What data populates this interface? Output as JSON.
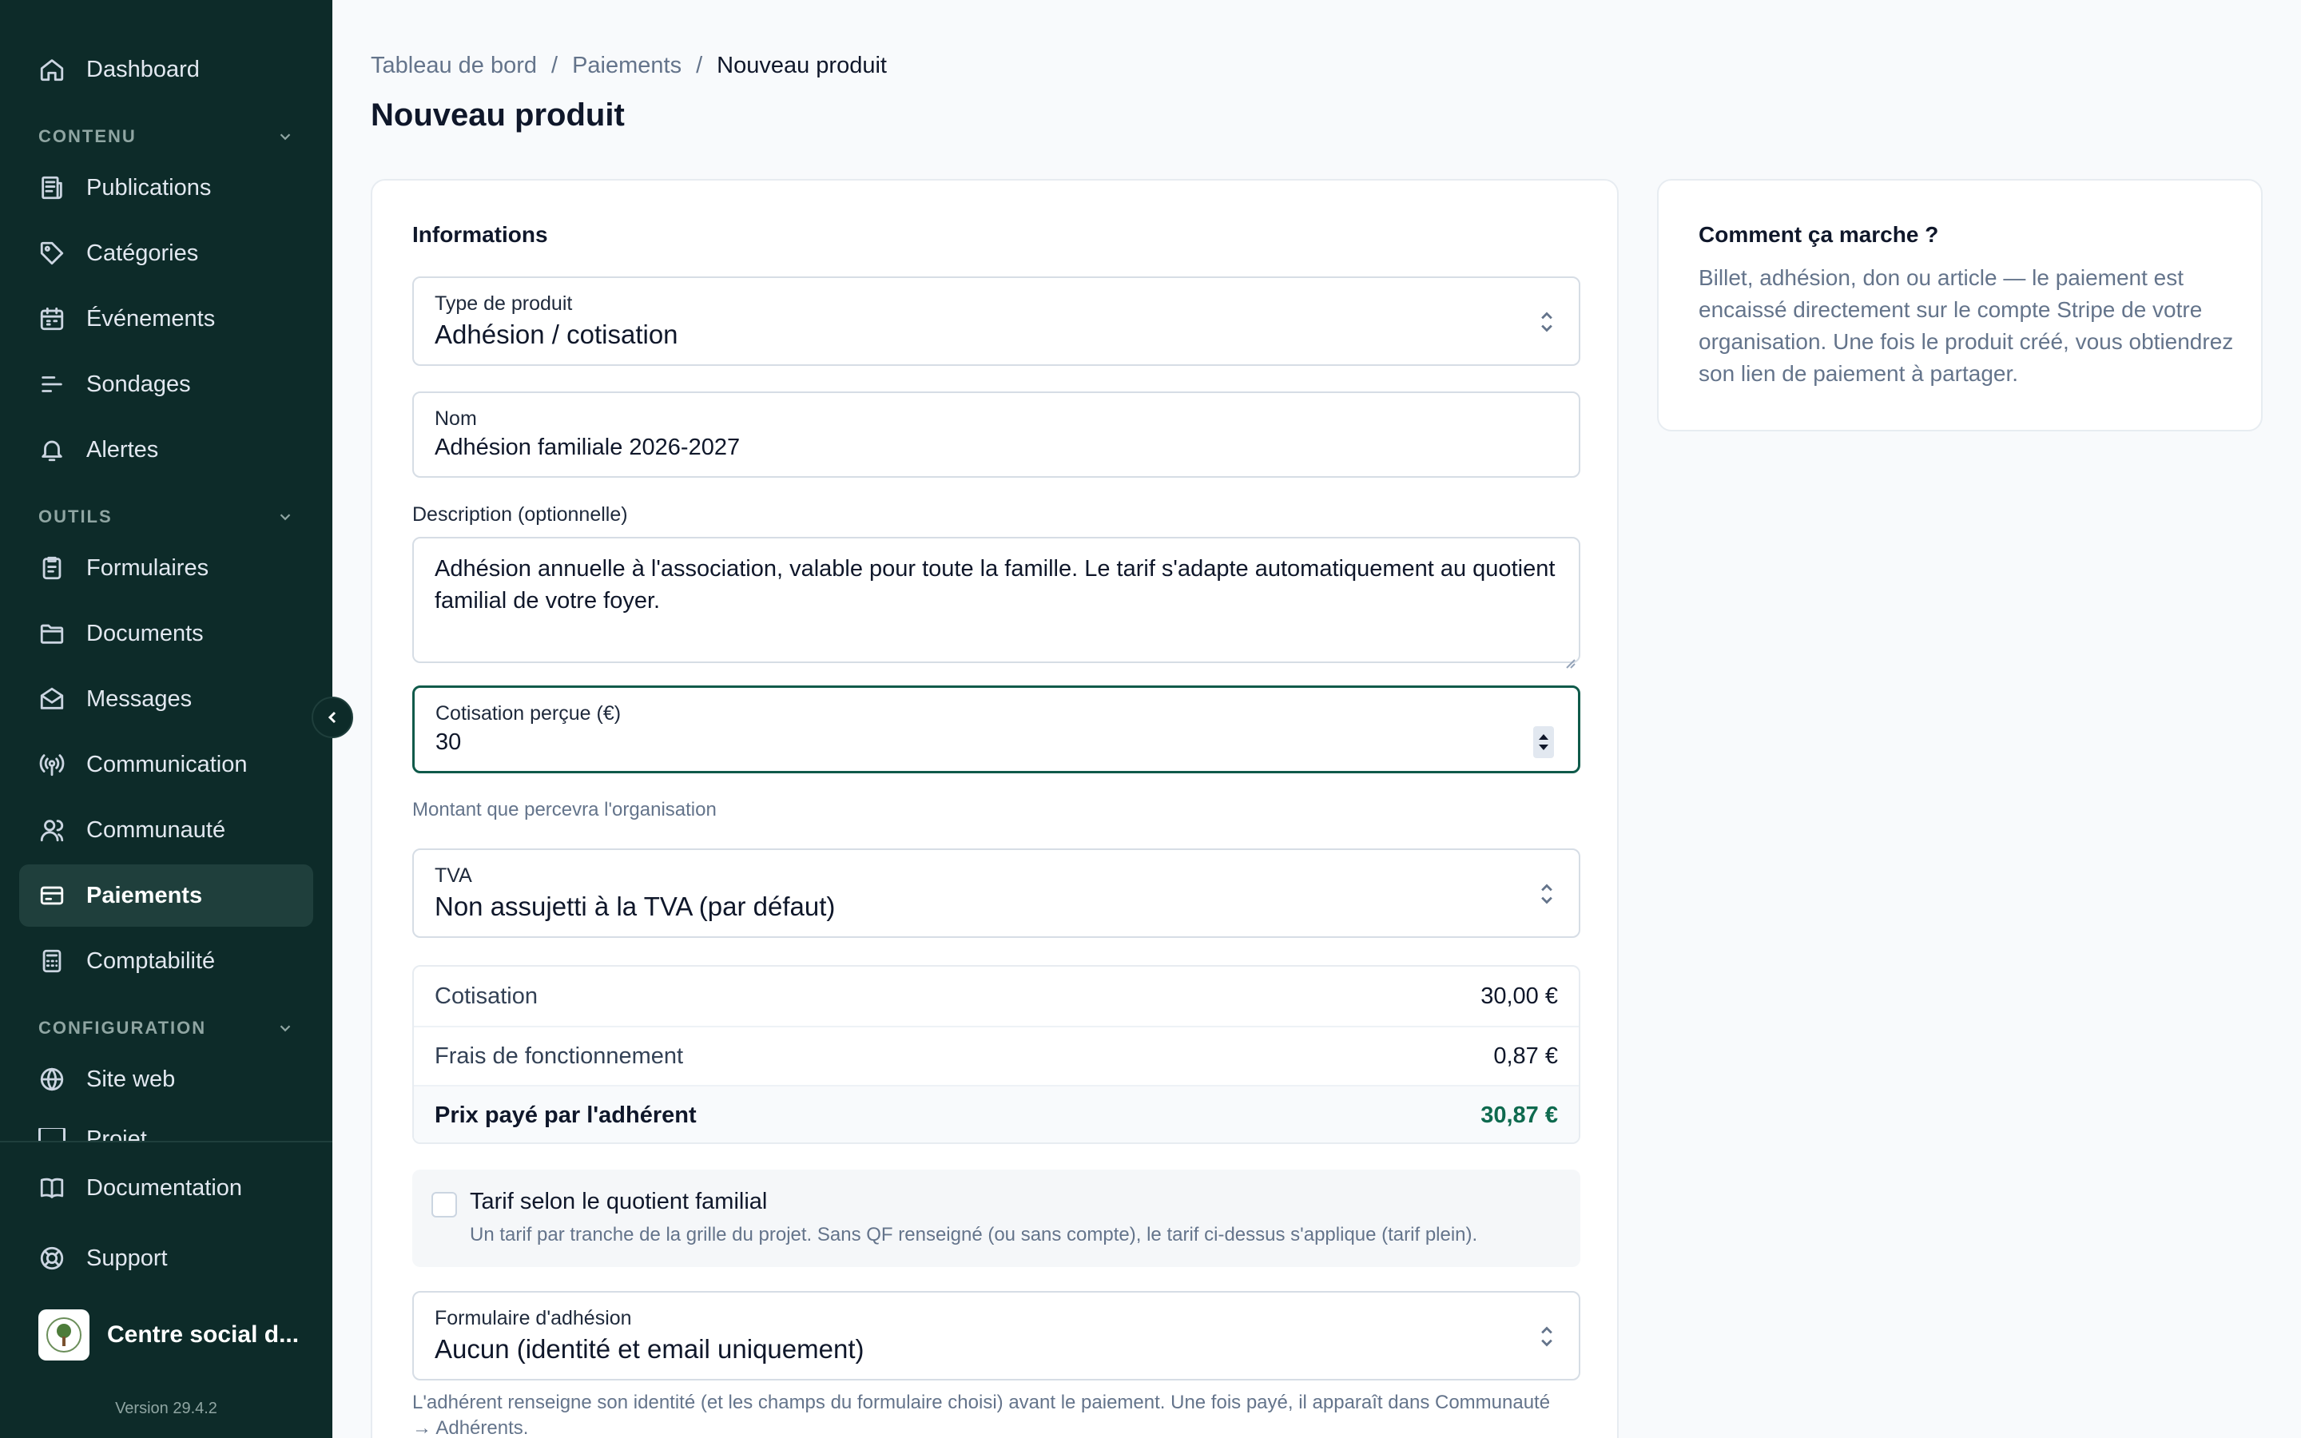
{
  "sidebar": {
    "top_item": {
      "label": "Dashboard",
      "icon": "home-icon"
    },
    "sections": [
      {
        "title": "CONTENU",
        "items": [
          {
            "label": "Publications",
            "icon": "newspaper-icon"
          },
          {
            "label": "Catégories",
            "icon": "tag-icon"
          },
          {
            "label": "Événements",
            "icon": "calendar-icon"
          },
          {
            "label": "Sondages",
            "icon": "poll-icon"
          },
          {
            "label": "Alertes",
            "icon": "bell-icon"
          }
        ]
      },
      {
        "title": "OUTILS",
        "items": [
          {
            "label": "Formulaires",
            "icon": "clipboard-icon"
          },
          {
            "label": "Documents",
            "icon": "folder-icon"
          },
          {
            "label": "Messages",
            "icon": "mail-icon"
          },
          {
            "label": "Communication",
            "icon": "broadcast-icon"
          },
          {
            "label": "Communauté",
            "icon": "users-icon"
          },
          {
            "label": "Paiements",
            "icon": "credit-card-icon",
            "active": true
          },
          {
            "label": "Comptabilité",
            "icon": "calculator-icon"
          }
        ]
      },
      {
        "title": "CONFIGURATION",
        "items": [
          {
            "label": "Site web",
            "icon": "globe-icon"
          },
          {
            "label": "Projet",
            "icon": "project-icon"
          }
        ]
      }
    ],
    "bottom_items": [
      {
        "label": "Documentation",
        "icon": "book-icon"
      },
      {
        "label": "Support",
        "icon": "lifebuoy-icon"
      }
    ],
    "org_name": "Centre social d...",
    "version": "Version 29.4.2"
  },
  "breadcrumb": {
    "items": [
      "Tableau de bord",
      "Paiements",
      "Nouveau produit"
    ],
    "separator": "/"
  },
  "page_title": "Nouveau produit",
  "form": {
    "section_title": "Informations",
    "product_type": {
      "label": "Type de produit",
      "value": "Adhésion / cotisation"
    },
    "name": {
      "label": "Nom",
      "value": "Adhésion familiale 2026-2027"
    },
    "description": {
      "label": "Description (optionnelle)",
      "value": "Adhésion annuelle à l'association, valable pour toute la famille. Le tarif s'adapte automatiquement au quotient familial de votre foyer."
    },
    "amount": {
      "label": "Cotisation perçue (€)",
      "value": "30",
      "hint": "Montant que percevra l'organisation"
    },
    "vat": {
      "label": "TVA",
      "value": "Non assujetti à la TVA (par défaut)"
    },
    "summary": [
      {
        "label": "Cotisation",
        "value": "30,00 €"
      },
      {
        "label": "Frais de fonctionnement",
        "value": "0,87 €"
      },
      {
        "label": "Prix payé par l'adhérent",
        "value": "30,87 €"
      }
    ],
    "qf": {
      "title": "Tarif selon le quotient familial",
      "description": "Un tarif par tranche de la grille du projet. Sans QF renseigné (ou sans compte), le tarif ci-dessus s'applique (tarif plein).",
      "checked": false
    },
    "membership_form": {
      "label": "Formulaire d'adhésion",
      "value": "Aucun (identité et email uniquement)"
    },
    "footer_text": "L'adhérent renseigne son identité (et les champs du formulaire choisi) avant le paiement. Une fois payé, il apparaît dans Communauté → Adhérents."
  },
  "help": {
    "title": "Comment ça marche ?",
    "text": "Billet, adhésion, don ou article — le paiement est encaissé directement sur le compte Stripe de votre organisation. Une fois le produit créé, vous obtiendrez son lien de paiement à partager."
  },
  "colors": {
    "sidebar_bg": "#0d2b29",
    "accent": "#0f5a4a",
    "total_green": "#0f6a4f"
  }
}
